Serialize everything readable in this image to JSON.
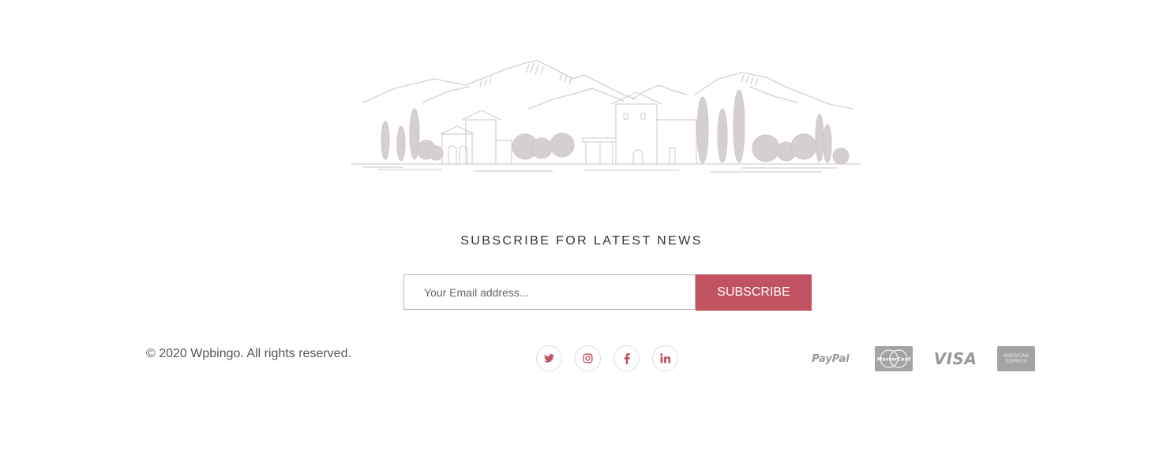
{
  "newsletter": {
    "title": "SUBSCRIBE FOR LATEST NEWS",
    "email_placeholder": "Your Email address...",
    "subscribe_label": "SUBSCRIBE"
  },
  "footer": {
    "copyright": "© 2020 Wpbingo. All rights reserved.",
    "social": [
      {
        "icon": "twitter-icon"
      },
      {
        "icon": "instagram-icon"
      },
      {
        "icon": "facebook-icon"
      },
      {
        "icon": "linkedin-icon"
      }
    ],
    "payments": {
      "paypal": "PayPal",
      "mastercard": "MasterCard",
      "visa": "VISA",
      "amex_line1": "AMERICAN",
      "amex_line2": "EXPRESS"
    }
  },
  "colors": {
    "accent": "#c1525f",
    "sketch": "#d3cccc",
    "text": "#555555"
  }
}
